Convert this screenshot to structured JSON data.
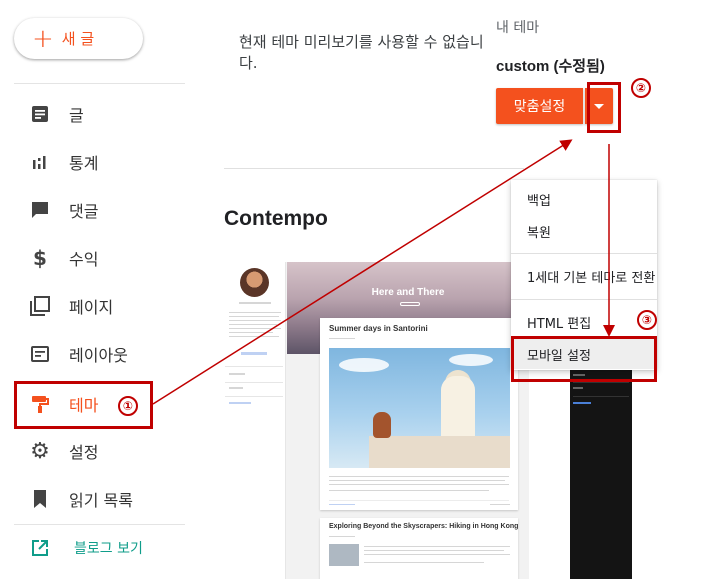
{
  "sidebar": {
    "new_post": {
      "icon": "plus-icon",
      "label": "새 글"
    },
    "items": [
      {
        "key": "posts",
        "label": "글",
        "icon": "document-icon"
      },
      {
        "key": "stats",
        "label": "통계",
        "icon": "bar-chart-icon"
      },
      {
        "key": "comments",
        "label": "댓글",
        "icon": "comment-icon"
      },
      {
        "key": "earnings",
        "label": "수익",
        "icon": "dollar-icon"
      },
      {
        "key": "pages",
        "label": "페이지",
        "icon": "pages-icon"
      },
      {
        "key": "layout",
        "label": "레이아웃",
        "icon": "layout-icon"
      },
      {
        "key": "theme",
        "label": "테마",
        "icon": "paint-roller-icon",
        "active": true
      },
      {
        "key": "settings",
        "label": "설정",
        "icon": "gear-icon"
      },
      {
        "key": "reading_list",
        "label": "읽기 목록",
        "icon": "bookmark-icon"
      }
    ],
    "view_blog": {
      "label": "블로그 보기",
      "icon": "open-external-icon"
    }
  },
  "main": {
    "preview_unavailable": "현재 테마 미리보기를 사용할 수 없습니다.",
    "theme_section_title": "Contempo"
  },
  "theme_panel": {
    "label": "내 테마",
    "current_theme": "custom (수정됨)",
    "customize_label": "맞춤설정",
    "dropdown_icon": "caret-down-icon"
  },
  "dropdown_menu": {
    "items": [
      {
        "label": "백업"
      },
      {
        "label": "복원"
      },
      {
        "label": "1세대 기본 테마로 전환"
      },
      {
        "label": "HTML 편집"
      },
      {
        "label": "모바일 설정",
        "highlighted": true
      }
    ]
  },
  "preview_thumbnail": {
    "hero_title": "Here and There",
    "post1_title": "Summer days in Santorini",
    "post2_title": "Exploring Beyond the Skyscrapers: Hiking in Hong Kong"
  },
  "annotations": {
    "step1": "①",
    "step2": "②",
    "step3": "③"
  },
  "colors": {
    "accent": "#f4511e",
    "annotation": "#c00000",
    "view_blog": "#0f9d8a"
  }
}
